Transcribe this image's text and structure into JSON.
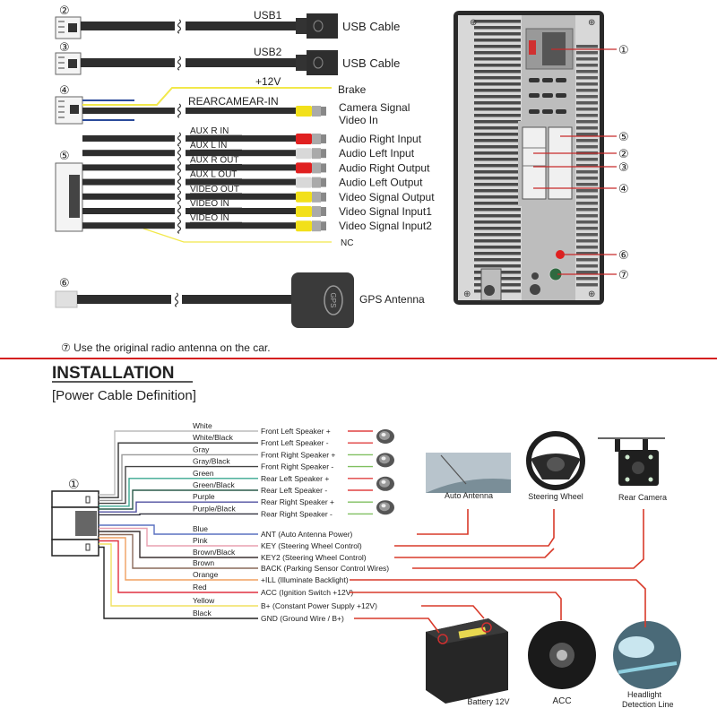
{
  "top_section": {
    "cables": [
      {
        "num": "②",
        "tag": "USB1",
        "label": "USB Cable"
      },
      {
        "num": "③",
        "tag": "USB2",
        "label": "USB Cable"
      }
    ],
    "cable4": {
      "num": "④",
      "power_tag": "+12V",
      "brake_label": "Brake",
      "camera_tag": "REARCAMEAR-IN",
      "camera_label_1": "Camera Signal",
      "camera_label_2": "Video In"
    },
    "cable5": {
      "num": "⑤",
      "lines": [
        {
          "tag": "AUX R IN",
          "label": "Audio Right Input",
          "plug_color": "#e02020"
        },
        {
          "tag": "AUX L IN",
          "label": "Audio Left Input",
          "plug_color": "#d8d8d8"
        },
        {
          "tag": "AUX R OUT",
          "label": "Audio Right Output",
          "plug_color": "#e02020"
        },
        {
          "tag": "AUX L OUT",
          "label": "Audio Left Output",
          "plug_color": "#d8d8d8"
        },
        {
          "tag": "VIDEO OUT",
          "label": "Video Signal Output",
          "plug_color": "#f2e01a"
        },
        {
          "tag": "VIDEO IN",
          "label": "Video Signal Input1",
          "plug_color": "#f2e01a"
        },
        {
          "tag": "VIDEO IN",
          "label": "Video Signal Input2",
          "plug_color": "#f2e01a"
        }
      ],
      "nc_label": "NC"
    },
    "gps": {
      "num": "⑥",
      "badge": "GPS",
      "label": "GPS Antenna"
    },
    "note": "⑦ Use the original radio antenna on the car.",
    "unit_callouts": [
      "①",
      "⑤",
      "②",
      "③",
      "④",
      "⑥",
      "⑦"
    ]
  },
  "installation": {
    "title": "INSTALLATION",
    "subtitle": "[Power Cable Definition]",
    "connector_num": "①",
    "speaker_wires": [
      {
        "color_name": "White",
        "function": "Front Left Speaker +",
        "wire_color": "#bbbbbb",
        "lead_color": "#e04040"
      },
      {
        "color_name": "White/Black",
        "function": "Front Left Speaker -",
        "wire_color": "#333333",
        "lead_color": "#e04040"
      },
      {
        "color_name": "Gray",
        "function": "Front Right Speaker +",
        "wire_color": "#999999",
        "lead_color": "#80c060"
      },
      {
        "color_name": "Gray/Black",
        "function": "Front Right Speaker -",
        "wire_color": "#444444",
        "lead_color": "#80c060"
      },
      {
        "color_name": "Green",
        "function": "Rear Left Speaker +",
        "wire_color": "#3aa890",
        "lead_color": "#e04040"
      },
      {
        "color_name": "Green/Black",
        "function": "Rear Left Speaker -",
        "wire_color": "#2a5a4a",
        "lead_color": "#e04040"
      },
      {
        "color_name": "Purple",
        "function": "Rear Right Speaker +",
        "wire_color": "#5050a0",
        "lead_color": "#80c060"
      },
      {
        "color_name": "Purple/Black",
        "function": "Rear Right Speaker -",
        "wire_color": "#333340",
        "lead_color": "#80c060"
      }
    ],
    "power_wires": [
      {
        "color_name": "Blue",
        "function": "ANT (Auto  Antenna Power)",
        "wire_color": "#5a70c0"
      },
      {
        "color_name": "Pink",
        "function": "KEY (Steering Wheel Control)",
        "wire_color": "#e8a0b0"
      },
      {
        "color_name": "Brown/Black",
        "function": "KEY2 (Steering Wheel Control)",
        "wire_color": "#3a3030"
      },
      {
        "color_name": "Brown",
        "function": "BACK (Parking Sensor Control Wires)",
        "wire_color": "#8a6a5a"
      },
      {
        "color_name": "Orange",
        "function": "+ILL (Illuminate Backlight)",
        "wire_color": "#f0a060"
      },
      {
        "color_name": "Red",
        "function": "ACC (Ignition Switch +12V)",
        "wire_color": "#e03040"
      },
      {
        "color_name": "Yellow",
        "function": "B+ (Constant Power Supply +12V)",
        "wire_color": "#f0e060"
      },
      {
        "color_name": "Black",
        "function": "GND (Ground Wire / B+)",
        "wire_color": "#222222"
      }
    ],
    "devices": [
      {
        "name": "auto-antenna",
        "label": "Auto Antenna"
      },
      {
        "name": "steering-wheel",
        "label": "Steering Wheel"
      },
      {
        "name": "rear-camera",
        "label": "Rear Camera"
      },
      {
        "name": "battery",
        "label": "Battery 12V"
      },
      {
        "name": "acc",
        "label": "ACC"
      },
      {
        "name": "headlight",
        "label_1": "Headlight",
        "label_2": "Detection Line"
      }
    ]
  },
  "colors": {
    "divider": "#d42020",
    "route_line": "#d83a2a",
    "cable": "#2e2e2e"
  }
}
